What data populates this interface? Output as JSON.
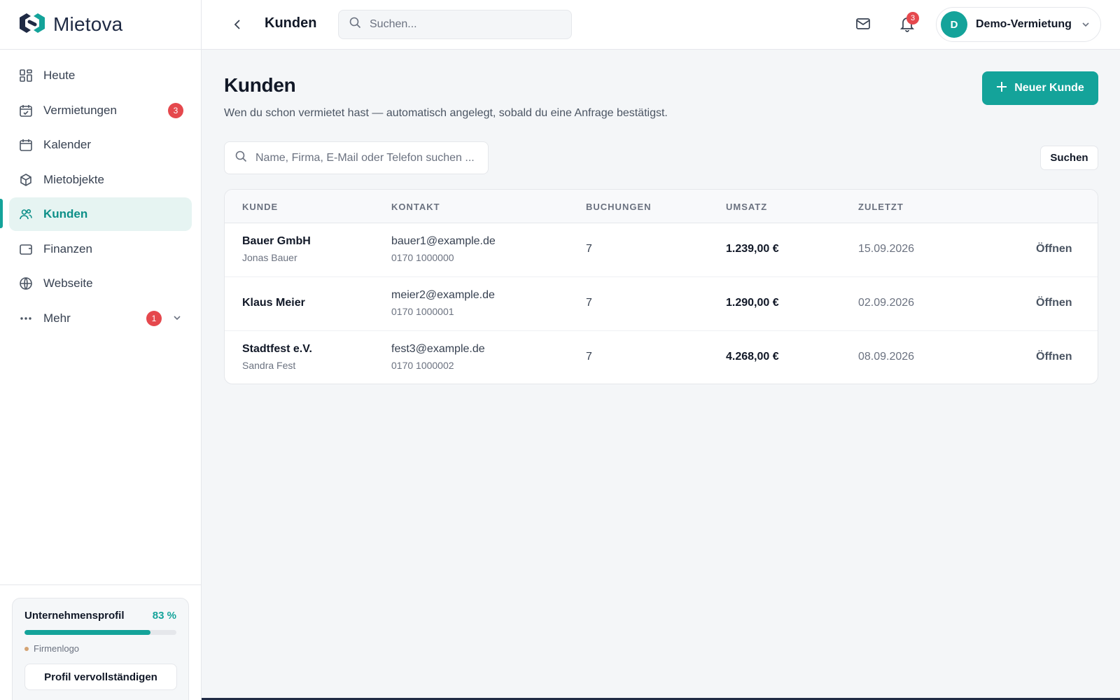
{
  "brand": {
    "name": "Mietova"
  },
  "sidebar": {
    "items": [
      {
        "label": "Heute",
        "icon": "dashboard-icon"
      },
      {
        "label": "Vermietungen",
        "icon": "calendar-check-icon",
        "badge": "3"
      },
      {
        "label": "Kalender",
        "icon": "calendar-icon"
      },
      {
        "label": "Mietobjekte",
        "icon": "box-icon"
      },
      {
        "label": "Kunden",
        "icon": "users-icon",
        "active": true
      },
      {
        "label": "Finanzen",
        "icon": "wallet-icon"
      },
      {
        "label": "Webseite",
        "icon": "globe-icon"
      },
      {
        "label": "Mehr",
        "icon": "more-icon",
        "badge": "1"
      }
    ],
    "profile": {
      "title": "Unternehmensprofil",
      "percent_label": "83 %",
      "percent": 83,
      "missing_item": "Firmenlogo",
      "button": "Profil vervollständigen"
    }
  },
  "topbar": {
    "title": "Kunden",
    "search_placeholder": "Suchen...",
    "notification_count": "3",
    "account_initial": "D",
    "account_name": "Demo-Vermietung"
  },
  "main": {
    "title": "Kunden",
    "subtitle": "Wen du schon vermietet hast — automatisch angelegt, sobald du eine Anfrage bestätigst.",
    "new_button": "Neuer Kunde",
    "search_placeholder": "Name, Firma, E-Mail oder Telefon suchen ...",
    "search_button": "Suchen",
    "table": {
      "headers": [
        "KUNDE",
        "KONTAKT",
        "BUCHUNGEN",
        "UMSATZ",
        "ZULETZT"
      ],
      "rows": [
        {
          "name": "Bauer GmbH",
          "contact_person": "Jonas Bauer",
          "email": "bauer1@example.de",
          "phone": "0170 1000000",
          "bookings": "7",
          "revenue": "1.239,00 €",
          "last": "15.09.2026",
          "action": "Öffnen"
        },
        {
          "name": "Klaus Meier",
          "contact_person": "",
          "email": "meier2@example.de",
          "phone": "0170 1000001",
          "bookings": "7",
          "revenue": "1.290,00 €",
          "last": "02.09.2026",
          "action": "Öffnen"
        },
        {
          "name": "Stadtfest e.V.",
          "contact_person": "Sandra Fest",
          "email": "fest3@example.de",
          "phone": "0170 1000002",
          "bookings": "7",
          "revenue": "4.268,00 €",
          "last": "08.09.2026",
          "action": "Öffnen"
        }
      ]
    }
  },
  "colors": {
    "accent": "#14a39a",
    "badge": "#e5484d",
    "brand_dark": "#1f2a44"
  }
}
